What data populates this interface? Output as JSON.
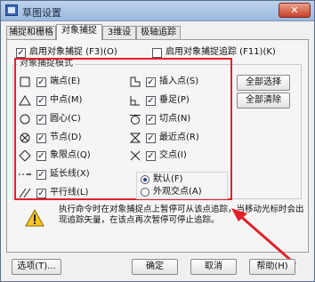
{
  "window": {
    "title": "草图设置",
    "close_glyph": "✕"
  },
  "tabs": [
    {
      "label": "捕捉和栅格",
      "active": false
    },
    {
      "label": "对象捕捉",
      "active": true
    },
    {
      "label": "3维设置",
      "active": false
    },
    {
      "label": "极轴追踪",
      "active": false
    }
  ],
  "options": {
    "enable_snap": {
      "label": "启用对象捕捉 (F3)(O)",
      "checked": true
    },
    "enable_tracking": {
      "label": "启用对象捕捉追踪 (F11)(K)",
      "checked": false
    }
  },
  "snap_modes": {
    "group_label": "对象捕捉模式",
    "left": [
      {
        "label": "端点(E)",
        "checked": true,
        "icon": "square-endpoint-icon"
      },
      {
        "label": "中点(M)",
        "checked": true,
        "icon": "triangle-midpoint-icon"
      },
      {
        "label": "圆心(C)",
        "checked": true,
        "icon": "circle-center-icon"
      },
      {
        "label": "节点(D)",
        "checked": true,
        "icon": "node-icon"
      },
      {
        "label": "象限点(Q)",
        "checked": true,
        "icon": "diamond-quadrant-icon"
      },
      {
        "label": "延长线(X)",
        "checked": true,
        "icon": "extension-icon"
      },
      {
        "label": "平行线(L)",
        "checked": true,
        "icon": "parallel-icon"
      }
    ],
    "right": [
      {
        "label": "插入点(S)",
        "checked": true,
        "icon": "insertion-icon"
      },
      {
        "label": "垂足(P)",
        "checked": true,
        "icon": "perpendicular-icon"
      },
      {
        "label": "切点(N)",
        "checked": true,
        "icon": "tangent-icon"
      },
      {
        "label": "最近点(R)",
        "checked": true,
        "icon": "nearest-icon"
      },
      {
        "label": "交点(I)",
        "checked": true,
        "icon": "intersection-icon"
      }
    ],
    "marker": {
      "default_label": "默认(F)",
      "apparent_label": "外观交点(A)",
      "selected": "default"
    }
  },
  "buttons": {
    "select_all": "全部选择",
    "clear_all": "全部清除",
    "options": "选项(T)...",
    "ok": "确定",
    "cancel": "取消",
    "help": "帮助(H)"
  },
  "note": {
    "line1": "执行命令时在对象捕捉点上暂停可从该点追踪，当移动光标时会出",
    "line2": "现追踪矢量，在该点再次暂停可停止追踪。"
  }
}
